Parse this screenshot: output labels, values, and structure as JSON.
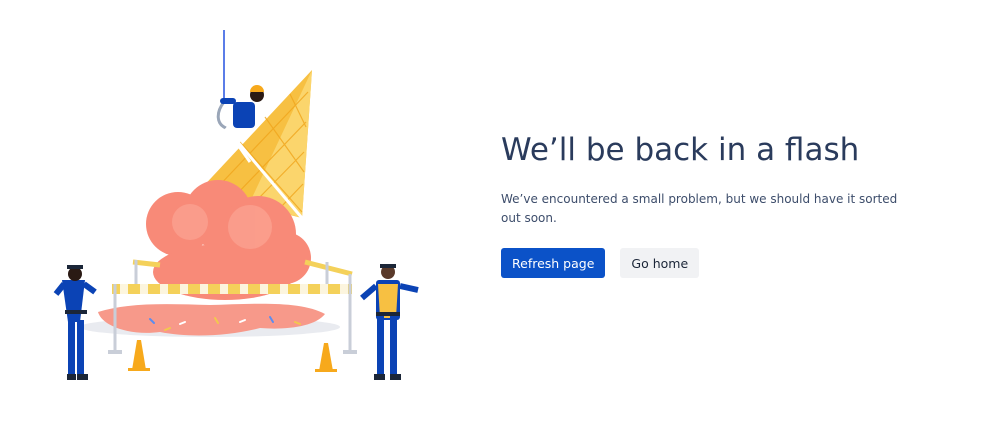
{
  "heading": "We’ll be back in a flash",
  "message": "We’ve encountered a small problem, but we should have it sorted out soon.",
  "actions": {
    "refresh_label": "Refresh page",
    "home_label": "Go home"
  },
  "colors": {
    "primary": "#0b52c8",
    "text": "#2a3b5c",
    "secondary_bg": "#f1f2f4",
    "cone": "#f7c042",
    "ice_cream": "#f88a78",
    "figure_blue": "#0b43b5"
  },
  "illustration": {
    "name": "melted-ice-cream-cone-with-workers-illustration"
  }
}
